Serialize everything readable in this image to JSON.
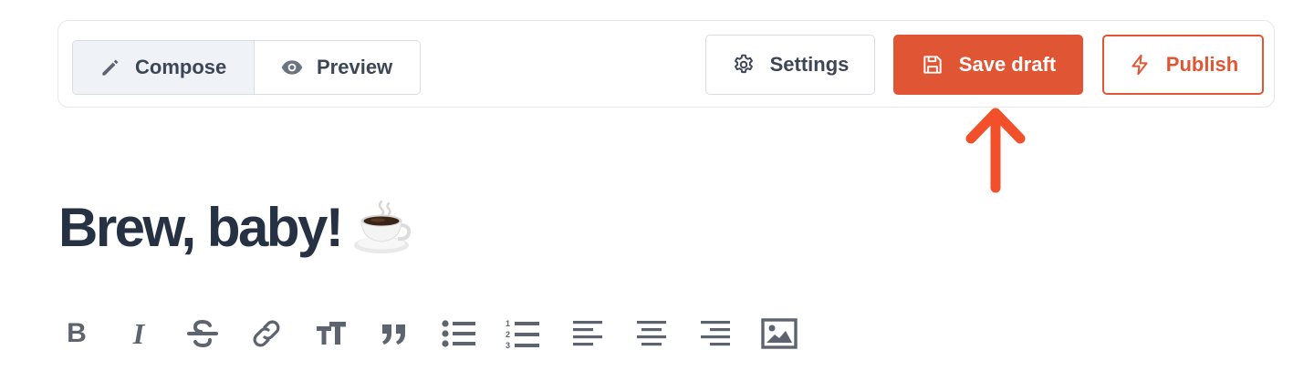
{
  "modes": {
    "compose_label": "Compose",
    "preview_label": "Preview"
  },
  "actions": {
    "settings_label": "Settings",
    "save_label": "Save draft",
    "publish_label": "Publish"
  },
  "post": {
    "title": "Brew, baby!",
    "title_emoji": "hot-beverage-icon"
  },
  "format_toolbar": {
    "bold_glyph": "B",
    "italic_glyph": "I",
    "items": [
      "bold-icon",
      "italic-icon",
      "strikethrough-icon",
      "link-icon",
      "text-size-icon",
      "quote-icon",
      "bullet-list-icon",
      "numbered-list-icon",
      "align-left-icon",
      "align-center-icon",
      "align-right-icon",
      "image-icon"
    ]
  },
  "colors": {
    "accent": "#e05533",
    "text_dark": "#263144",
    "icon_gray": "#5d6470"
  }
}
